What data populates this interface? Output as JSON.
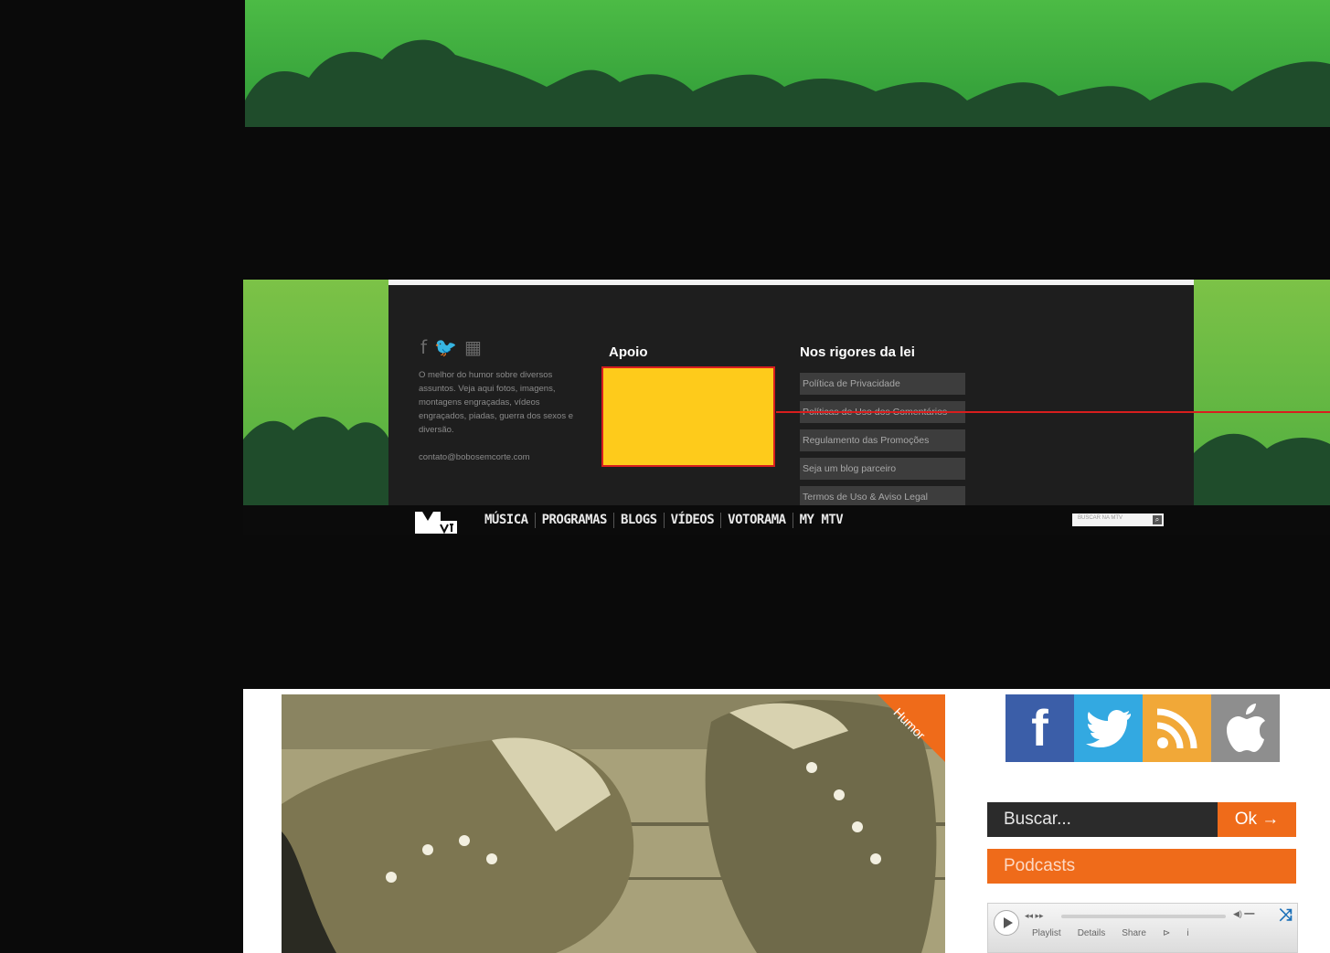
{
  "colors": {
    "green_light": "#4cbb45",
    "green_dark": "#1f4c2b",
    "footer_panel": "#1e1e1e",
    "highlight_red": "#d81e1e",
    "banner_yellow": "#fecb1b",
    "orange": "#ef6b1a"
  },
  "footer": {
    "social_icons": [
      "facebook-icon",
      "twitter-icon",
      "delicious-icon"
    ],
    "about_text": "O melhor do humor sobre diversos assuntos. Veja aqui fotos, imagens, montagens engraçadas, vídeos engraçados, piadas, guerra dos sexos e diversão.",
    "email": "contato@bobosemcorte.com",
    "apoio_title": "Apoio",
    "leis_title": "Nos rigores da lei",
    "links": [
      "Política de Privacidade",
      "Políticas de Uso dos Comentários",
      "Regulamento das Promoções",
      "Seja um blog parceiro",
      "Termos de Uso & Aviso Legal"
    ]
  },
  "mtvbar": {
    "nav": [
      "MÚSICA",
      "PROGRAMAS",
      "BLOGS",
      "VÍDEOS",
      "VOTORAMA",
      "MY MTV"
    ],
    "search_placeholder": "BUSCAR NA MTV"
  },
  "blog": {
    "category_tag": "Humor",
    "social_buttons": [
      {
        "icon": "facebook-icon",
        "glyph": "f",
        "color": "#3b5ea8"
      },
      {
        "icon": "twitter-icon",
        "glyph": "🐦",
        "color": "#33a9e1"
      },
      {
        "icon": "rss-icon",
        "glyph": "◔",
        "color": "#f1a838"
      },
      {
        "icon": "apple-icon",
        "glyph": "",
        "color": "#8e8e8e"
      }
    ],
    "search_placeholder": "Buscar...",
    "search_button": "Ok →",
    "podcasts_label": "Podcasts",
    "player_tabs": [
      "Playlist",
      "Details",
      "Share",
      "⊳",
      "i"
    ]
  }
}
